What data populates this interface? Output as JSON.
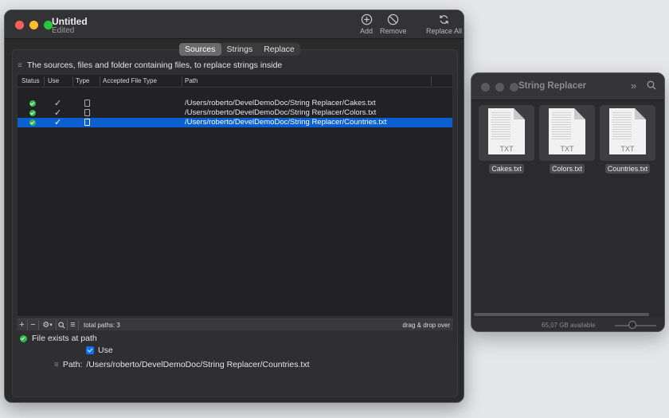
{
  "main_window": {
    "title": "Untitled",
    "subtitle": "Edited",
    "toolbar": {
      "add_label": "Add",
      "remove_label": "Remove",
      "replace_all_label": "Replace All"
    },
    "tabs": [
      "Sources",
      "Strings",
      "Replace"
    ],
    "active_tab": "Sources",
    "description": "The sources, files and folder containing files, to replace strings inside",
    "table": {
      "columns": [
        "Status",
        "Use",
        "Type",
        "Accepted File Type",
        "Path"
      ],
      "rows": [
        {
          "path": "/Users/roberto/DevelDemoDoc/String Replacer/Cakes.txt",
          "status": "ok",
          "use": true,
          "selected": false
        },
        {
          "path": "/Users/roberto/DevelDemoDoc/String Replacer/Colors.txt",
          "status": "ok",
          "use": true,
          "selected": false
        },
        {
          "path": "/Users/roberto/DevelDemoDoc/String Replacer/Countries.txt",
          "status": "ok",
          "use": true,
          "selected": true
        }
      ]
    },
    "footer": {
      "total_paths": "total paths: 3",
      "drag_hint": "drag & drop over"
    },
    "details": {
      "exists_text": "File exists at path",
      "use_label": "Use",
      "use_checked": true,
      "path_label": "Path:",
      "path_value": "/Users/roberto/DevelDemoDoc/String Replacer/Countries.txt"
    }
  },
  "finder_window": {
    "title": "String Replacer",
    "files": [
      {
        "name": "Cakes.txt",
        "ext": "TXT"
      },
      {
        "name": "Colors.txt",
        "ext": "TXT"
      },
      {
        "name": "Countries.txt",
        "ext": "TXT"
      }
    ],
    "available": "65,07 GB available"
  },
  "colors": {
    "accent": "#0a5fd1",
    "status_ok": "#2eb84a",
    "window_bg": "#2a2a2a"
  }
}
